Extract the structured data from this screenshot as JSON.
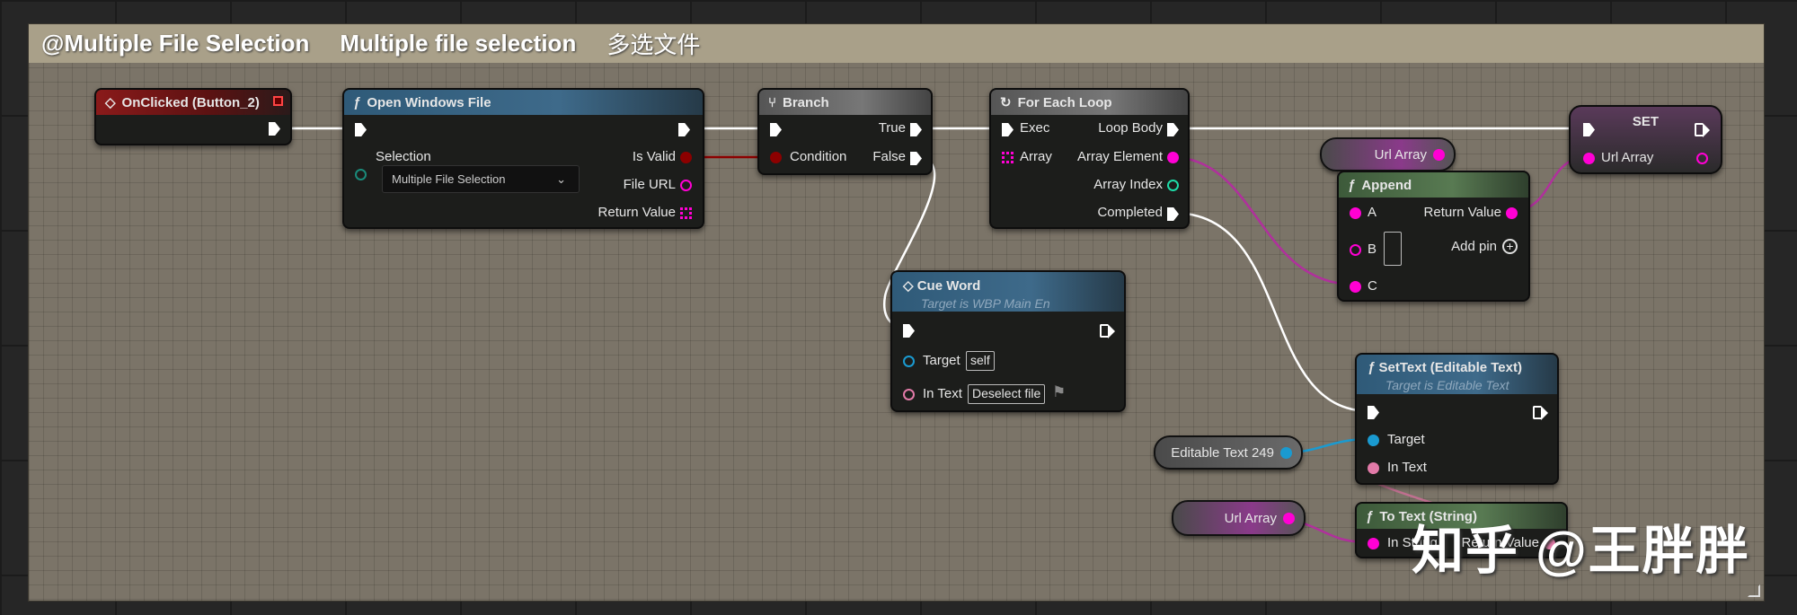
{
  "comment": {
    "title": "@Multiple File Selection",
    "subtitle": "Multiple file selection",
    "cn": "多选文件"
  },
  "nodes": {
    "onclicked": {
      "title": "OnClicked (Button_2)"
    },
    "open_file": {
      "title": "Open Windows File",
      "selection_label": "Selection",
      "selection_value": "Multiple File Selection",
      "is_valid": "Is Valid",
      "file_url": "File URL",
      "return_value": "Return Value"
    },
    "branch": {
      "title": "Branch",
      "true": "True",
      "false": "False",
      "condition": "Condition"
    },
    "for_each": {
      "title": "For Each Loop",
      "exec": "Exec",
      "loop_body": "Loop Body",
      "array": "Array",
      "array_element": "Array Element",
      "array_index": "Array Index",
      "completed": "Completed"
    },
    "url_array_var": {
      "label": "Url Array"
    },
    "append": {
      "title": "Append",
      "a": "A",
      "b": "B",
      "c": "C",
      "return_value": "Return Value",
      "add_pin": "Add pin"
    },
    "set": {
      "title": "SET",
      "url_array": "Url Array"
    },
    "cue_word": {
      "title": "Cue Word",
      "subtitle": "Target is WBP Main En",
      "target": "Target",
      "target_value": "self",
      "in_text": "In Text",
      "in_text_value": "Deselect file"
    },
    "set_text": {
      "title": "SetText (Editable Text)",
      "subtitle": "Target is Editable Text",
      "target": "Target",
      "in_text": "In Text"
    },
    "editable_text_var": {
      "label": "Editable Text 249"
    },
    "url_array_var2": {
      "label": "Url Array"
    },
    "to_text": {
      "title": "To Text (String)",
      "in_string": "In String",
      "return_value": "Return Value"
    }
  },
  "watermark": "知乎 @王胖胖",
  "colors": {
    "exec": "#ffffff",
    "bool": "#8c0000",
    "string": "#ff00d4",
    "object": "#00a8f0",
    "int": "#1edca8",
    "text": "#e27aa8"
  }
}
